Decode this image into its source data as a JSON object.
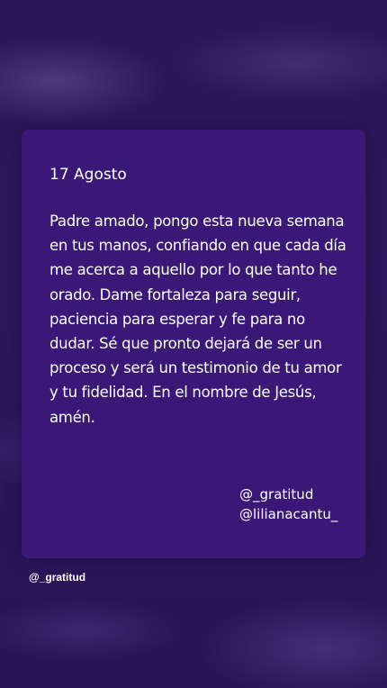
{
  "card": {
    "date": "17 Agosto",
    "prayer": "Padre amado, pongo esta nueva semana en tus manos, confiando en que cada día me acerca a aquello por lo que tanto he orado. Dame fortaleza para seguir, paciencia para esperar y fe para no dudar. Sé que pronto dejará de ser un proceso y será un testimonio de tu amor y tu fidelidad. En el nombre de Jesús, amén.",
    "handles": [
      "@_gratitud",
      "@lilianacantu_"
    ]
  },
  "watermark": "@_gratitud",
  "colors": {
    "background": "#2a1559",
    "card": "#3a1877",
    "text": "#ffffff"
  }
}
